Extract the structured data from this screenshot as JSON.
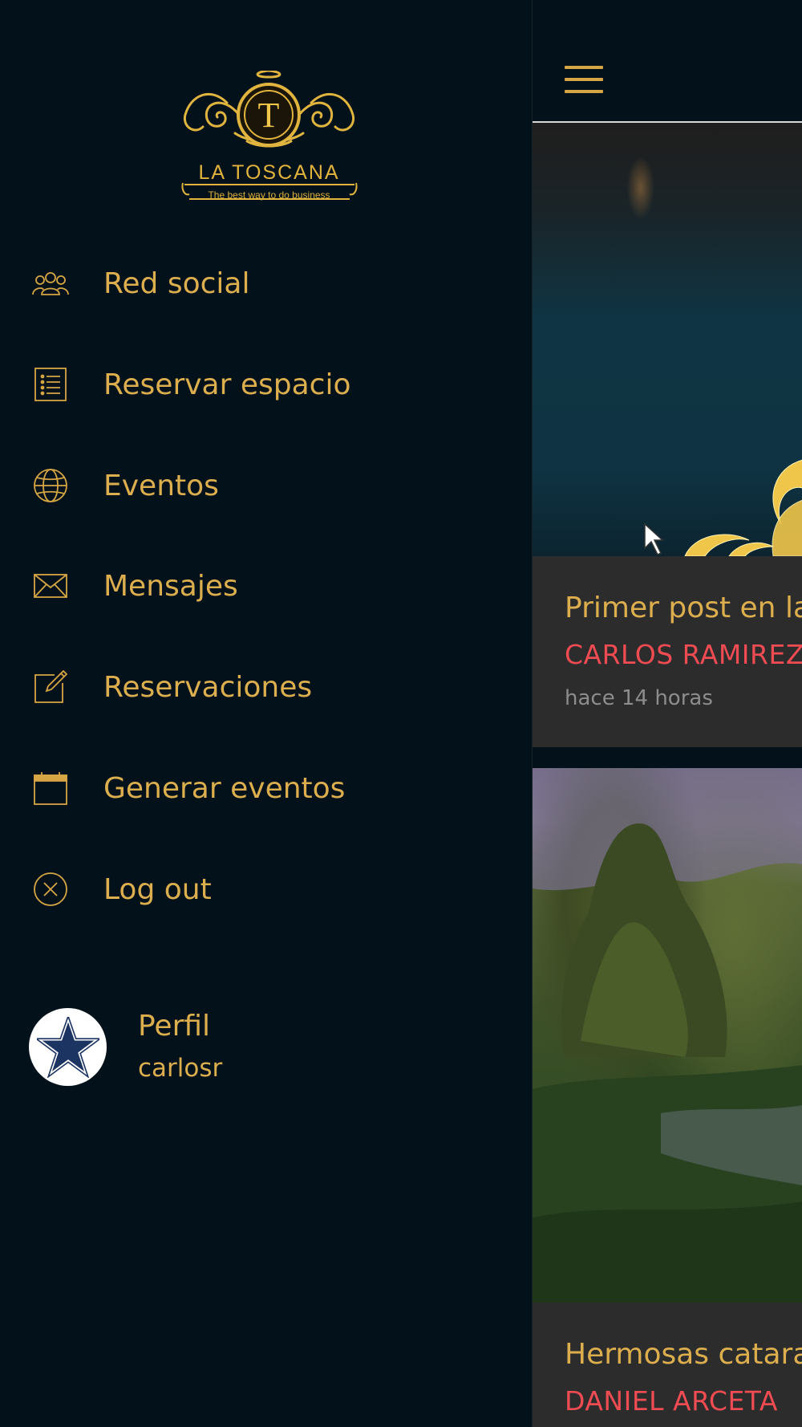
{
  "brand": {
    "name": "LA TOSCANA",
    "tagline": "The best way to do business",
    "monogram": "T"
  },
  "menu": [
    {
      "label": "Red social",
      "icon": "users-icon"
    },
    {
      "label": "Reservar espacio",
      "icon": "list-icon"
    },
    {
      "label": "Eventos",
      "icon": "globe-icon"
    },
    {
      "label": "Mensajes",
      "icon": "envelope-icon"
    },
    {
      "label": "Reservaciones",
      "icon": "edit-icon"
    },
    {
      "label": "Generar eventos",
      "icon": "calendar-icon"
    },
    {
      "label": "Log out",
      "icon": "close-circle-icon"
    }
  ],
  "profile": {
    "title": "Perfil",
    "username": "carlosr",
    "avatar_icon": "star-icon"
  },
  "feed": {
    "posts": [
      {
        "title": "Primer post en la",
        "author": "CARLOS RAMIREZ",
        "time": "hace 14 horas"
      },
      {
        "title": "Hermosas catara",
        "author": "DANIEL ARCETA"
      }
    ]
  },
  "colors": {
    "background": "#03121a",
    "gold": "#dcae4e",
    "accent_red": "#ef4b52",
    "card": "#2c2c2c",
    "muted": "#8d8d8d"
  }
}
